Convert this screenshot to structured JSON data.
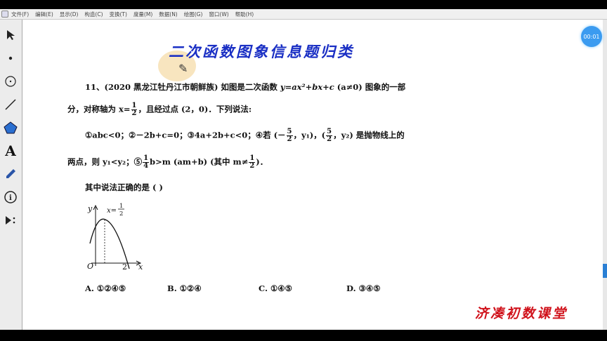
{
  "menu": [
    "文件(F)",
    "编辑(E)",
    "显示(D)",
    "构造(C)",
    "变换(T)",
    "度量(M)",
    "数据(N)",
    "绘图(G)",
    "窗口(W)",
    "帮助(H)"
  ],
  "timer": "00:01",
  "title": "二次函数图象信息题归类",
  "problem": {
    "l1a": "11、(2020 黑龙江牡丹江市朝鲜族) 如图是二次函数 ",
    "l1b": "y=ax²+bx+c",
    "l1c": " (a≠0) 图象的一部",
    "l2a": "分，对称轴为 x=",
    "half_num": "1",
    "half_den": "2",
    "l2b": "，且经过点 (2，0)．下列说法:",
    "l3a": "①abc<0；②－2b+c=0；③4a+2b+c<0；④若 (－",
    "five_num": "5",
    "l3b": "，y₁)，(",
    "l3c": "，y₂) 是抛物线上的",
    "l4a": "两点，则 y₁<y₂；⑤",
    "quarter_num": "1",
    "quarter_den": "4",
    "l4b": "b>m (am+b) (其中 m≠",
    "l4c": ")．",
    "l5": "其中说法正确的是 (      )"
  },
  "graph": {
    "y": "y",
    "x": "x",
    "o": "O",
    "two": "2",
    "axis_label": "x=",
    "axis_num": "1",
    "axis_den": "2"
  },
  "options": {
    "a": "A. ①②④⑤",
    "b": "B. ①②④",
    "c": "C. ①④⑤",
    "d": "D. ③④⑤"
  },
  "brand": "济凑初数课堂"
}
